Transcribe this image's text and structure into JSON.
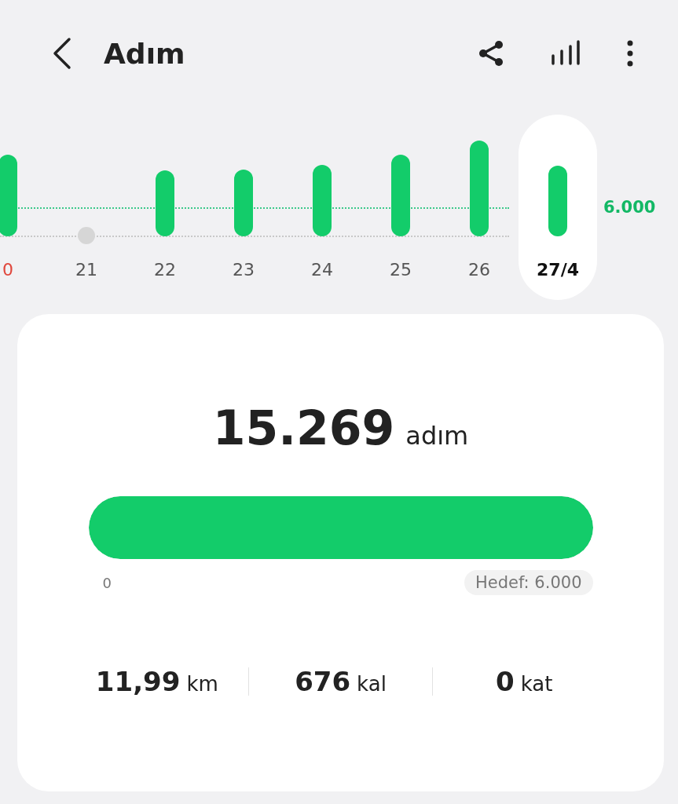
{
  "header": {
    "title": "Adım"
  },
  "chart": {
    "goal_label": "6.000",
    "days": [
      {
        "label": "0",
        "kind": "bar",
        "selected": false,
        "color": "#e0473c"
      },
      {
        "label": "21",
        "kind": "dot",
        "selected": false,
        "color": "#555555"
      },
      {
        "label": "22",
        "kind": "bar",
        "selected": false,
        "color": "#555555"
      },
      {
        "label": "23",
        "kind": "bar",
        "selected": false,
        "color": "#555555"
      },
      {
        "label": "24",
        "kind": "bar",
        "selected": false,
        "color": "#555555"
      },
      {
        "label": "25",
        "kind": "bar",
        "selected": false,
        "color": "#555555"
      },
      {
        "label": "26",
        "kind": "bar",
        "selected": false,
        "color": "#555555"
      },
      {
        "label": "27/4",
        "kind": "bar",
        "selected": true,
        "color": "#111111"
      }
    ]
  },
  "summary": {
    "steps": "15.269",
    "steps_unit": "adım",
    "progress": {
      "level": 1,
      "start": "0",
      "goal": "Hedef: 6.000"
    },
    "stats": [
      {
        "value": "11,99",
        "unit": "km"
      },
      {
        "value": "676",
        "unit": "kal"
      },
      {
        "value": "0",
        "unit": "kat"
      }
    ]
  }
}
